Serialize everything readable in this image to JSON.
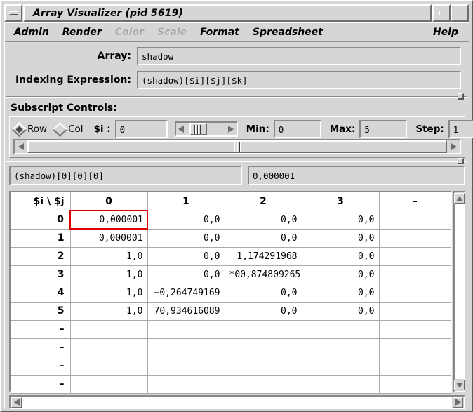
{
  "window": {
    "title": "Array Visualizer (pid 5619)",
    "minimize_icon": "minimize-icon",
    "restore_icon": "restore-icon",
    "maximize_icon": "maximize-icon"
  },
  "menubar": {
    "items": [
      {
        "label": "Admin",
        "mnemonic": "A",
        "disabled": false
      },
      {
        "label": "Render",
        "mnemonic": "R",
        "disabled": false
      },
      {
        "label": "Color",
        "mnemonic": "C",
        "disabled": true
      },
      {
        "label": "Scale",
        "mnemonic": "S",
        "disabled": true
      },
      {
        "label": "Format",
        "mnemonic": "F",
        "disabled": false
      },
      {
        "label": "Spreadsheet",
        "mnemonic": "S",
        "disabled": false
      }
    ],
    "help": {
      "label": "Help",
      "mnemonic": "H",
      "disabled": false
    }
  },
  "form": {
    "array_label": "Array:",
    "array_value": "shadow",
    "array_placeholder": "",
    "index_label": "Indexing Expression:",
    "index_value": "(shadow)[$i][$j][$k]",
    "index_placeholder": ""
  },
  "subscript": {
    "section_title": "Subscript Controls:",
    "row_label": "Row",
    "col_label": "Col",
    "row_selected": true,
    "col_selected": false,
    "subscript_label": "$i :",
    "subscript_value": "0",
    "min_label": "Min:",
    "min_value": "0",
    "max_label": "Max:",
    "max_value": "5",
    "step_label": "Step:",
    "step_value": "1"
  },
  "cellbar": {
    "reference": "(shadow)[0][0][0]",
    "value": "0,000001"
  },
  "sheet": {
    "corner_label": "$i \\ $j",
    "columns": [
      "0",
      "1",
      "2",
      "3",
      "–"
    ],
    "rows": [
      {
        "label": "0",
        "cells": [
          "0,000001",
          "0,0",
          "0,0",
          "0,0",
          ""
        ]
      },
      {
        "label": "1",
        "cells": [
          "0,000001",
          "0,0",
          "0,0",
          "0,0",
          ""
        ]
      },
      {
        "label": "2",
        "cells": [
          "1,0",
          "0,0",
          "1,174291968",
          "0,0",
          ""
        ]
      },
      {
        "label": "3",
        "cells": [
          "1,0",
          "0,0",
          "*00,874809265",
          "0,0",
          ""
        ]
      },
      {
        "label": "4",
        "cells": [
          "1,0",
          "−0,264749169",
          "0,0",
          "0,0",
          ""
        ]
      },
      {
        "label": "5",
        "cells": [
          "1,0",
          "70,934616089",
          "0,0",
          "0,0",
          ""
        ]
      },
      {
        "label": "–",
        "cells": [
          "",
          "",
          "",
          "",
          ""
        ]
      },
      {
        "label": "–",
        "cells": [
          "",
          "",
          "",
          "",
          ""
        ]
      },
      {
        "label": "–",
        "cells": [
          "",
          "",
          "",
          "",
          ""
        ]
      },
      {
        "label": "–",
        "cells": [
          "",
          "",
          "",
          "",
          ""
        ]
      }
    ],
    "selected_cell": {
      "row": 0,
      "col": 0
    },
    "selection_color": "#e00000"
  },
  "colors": {
    "background": "#d6d6d6",
    "field_background": "#d6d6d6",
    "sheet_background": "#ffffff",
    "text": "#000000",
    "disabled_text": "#a8a8a8",
    "selection_border": "#e00000"
  }
}
